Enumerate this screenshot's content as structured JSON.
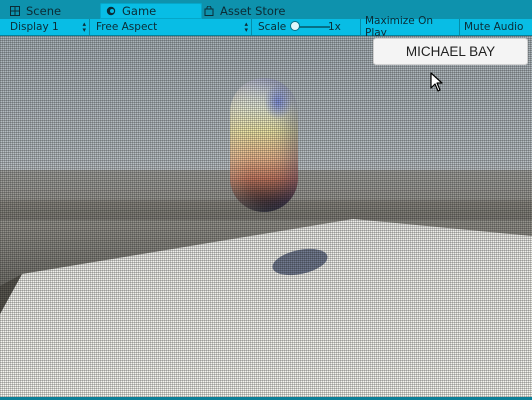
{
  "tabs": [
    {
      "label": "Scene",
      "icon": "scene-grid-icon",
      "active": false
    },
    {
      "label": "Game",
      "icon": "game-controller-icon",
      "active": true
    },
    {
      "label": "Asset Store",
      "icon": "shopping-bag-icon",
      "active": false
    }
  ],
  "toolbar": {
    "display_value": "Display 1",
    "aspect_value": "Free Aspect",
    "scale_label": "Scale",
    "scale_value": "1x",
    "maximize_label": "Maximize On Play",
    "mute_label": "Mute Audio"
  },
  "game_view": {
    "button_label": "MICHAEL BAY"
  },
  "colors": {
    "tab_bar": "#0e92ad",
    "toolbar": "#08bde5",
    "button_bg": "#f4f4f4"
  }
}
